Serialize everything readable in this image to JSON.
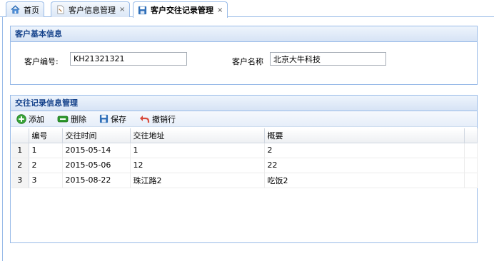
{
  "tabs": [
    {
      "label": "首页",
      "icon": "home-icon",
      "closable": false
    },
    {
      "label": "客户信息管理",
      "icon": "page-icon",
      "closable": true
    },
    {
      "label": "客户交往记录管理",
      "icon": "save-icon",
      "closable": true
    }
  ],
  "tab_close_glyph": "×",
  "basic_info": {
    "title": "客户基本信息",
    "code_label": "客户编号:",
    "code_value": "KH21321321",
    "name_label": "客户名称",
    "name_value": "北京大牛科技"
  },
  "records": {
    "title": "交往记录信息管理",
    "toolbar": {
      "add": "添加",
      "delete": "删除",
      "save": "保存",
      "undo": "撤销行"
    },
    "columns": [
      "编号",
      "交往时间",
      "交往地址",
      "概要"
    ],
    "rows": [
      {
        "rownum": "1",
        "cells": [
          "1",
          "2015-05-14",
          "1",
          "2"
        ]
      },
      {
        "rownum": "2",
        "cells": [
          "2",
          "2015-05-06",
          "12",
          "22"
        ]
      },
      {
        "rownum": "3",
        "cells": [
          "3",
          "2015-08-22",
          "珠江路2",
          "吃饭2"
        ]
      }
    ]
  }
}
